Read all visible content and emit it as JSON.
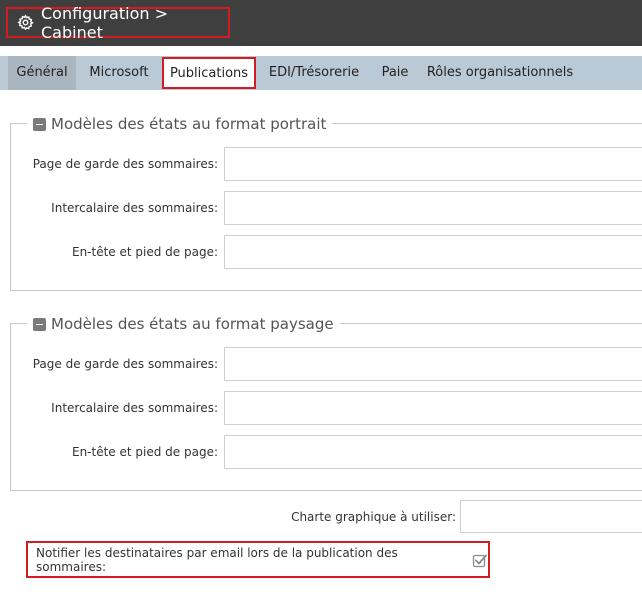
{
  "header": {
    "title": "Configuration > Cabinet",
    "icon": "gear-icon"
  },
  "tabs": [
    {
      "label": "Général"
    },
    {
      "label": "Microsoft"
    },
    {
      "label": "Publications"
    },
    {
      "label": "EDI/Trésorerie"
    },
    {
      "label": "Paie"
    },
    {
      "label": "Rôles organisationnels"
    }
  ],
  "selected_tab": "Publications",
  "portrait": {
    "legend": "Modèles des états au format portrait",
    "fields": [
      {
        "label": "Page de garde des sommaires:",
        "value": ""
      },
      {
        "label": "Intercalaire des sommaires:",
        "value": ""
      },
      {
        "label": "En-tête et pied de page:",
        "value": ""
      }
    ]
  },
  "paysage": {
    "legend": "Modèles des états au format paysage",
    "fields": [
      {
        "label": "Page de garde des sommaires:",
        "value": ""
      },
      {
        "label": "Intercalaire des sommaires:",
        "value": ""
      },
      {
        "label": "En-tête et pied de page:",
        "value": ""
      }
    ]
  },
  "charte": {
    "label": "Charte graphique à utiliser:",
    "value": ""
  },
  "notify": {
    "label": "Notifier les destinataires par email lors de la publication des sommaires:",
    "checked": true
  },
  "colors": {
    "header_bg": "#3f3f3f",
    "tabbar_bg": "#b9c9d6",
    "highlight": "#d51b22"
  }
}
